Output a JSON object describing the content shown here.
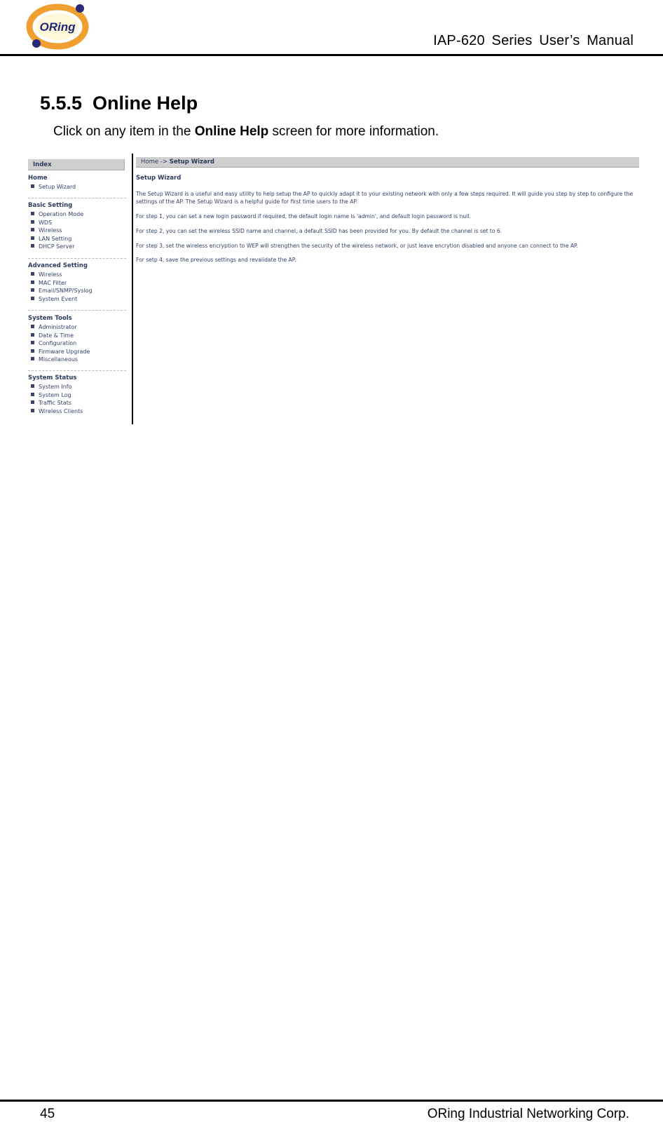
{
  "header": {
    "logo_text": "ORing",
    "manual_title": "IAP-620  Series  User’s  Manual"
  },
  "section": {
    "title": "5.5.5  Online Help",
    "intro_before": "Click on any item in the ",
    "intro_bold": "Online Help",
    "intro_after": " screen for more information."
  },
  "screenshot": {
    "sidebar": {
      "header": "Index",
      "groups": [
        {
          "title": "Home",
          "items": [
            "Setup Wizard"
          ]
        },
        {
          "title": "Basic Setting",
          "items": [
            "Operation Mode",
            "WDS",
            "Wireless",
            "LAN Setting",
            "DHCP Server"
          ]
        },
        {
          "title": "Advanced Setting",
          "items": [
            "Wireless",
            "MAC Filter",
            "Email/SNMP/Syslog",
            "System Event"
          ]
        },
        {
          "title": "System Tools",
          "items": [
            "Administrator",
            "Date & Time",
            "Configuration",
            "Firmware Upgrade",
            "Miscellaneous"
          ]
        },
        {
          "title": "System Status",
          "items": [
            "System Info",
            "System Log",
            "Traffic Stats",
            "Wireless Clients"
          ]
        }
      ]
    },
    "main": {
      "breadcrumb_home": "Home -> ",
      "breadcrumb_current": "Setup Wizard",
      "title": "Setup Wizard",
      "paragraphs": [
        "The Setup Wizard is a useful and easy utility to help setup the AP to quickly adapt it to your existing network with only a few steps required. It will guide you step by step to configure the",
        "settings of the AP. The Setup Wizard is a helpful guide for first time users to the AP.",
        "For step 1, you can set a new login password if required, the default login name is 'admin', and default login password is null.",
        "For step 2, you can set the wireless SSID name and channel, a default SSID has been provided for you. By default the channel is set to 6.",
        "For step 3, set the wireless encryption to WEP will strengthen the security of the wireless network, or just leave encrytion disabled and anyone can connect to the AP.",
        "For setp 4, save the previous settings and revalidate the AP."
      ]
    }
  },
  "footer": {
    "page_number": "45",
    "company": "ORing Industrial Networking Corp."
  },
  "colors": {
    "logo_ring": "#f0a030",
    "logo_dot": "#2a2a7a",
    "panel_header_bg": "#cfcfcf",
    "link_text": "#34406a"
  }
}
